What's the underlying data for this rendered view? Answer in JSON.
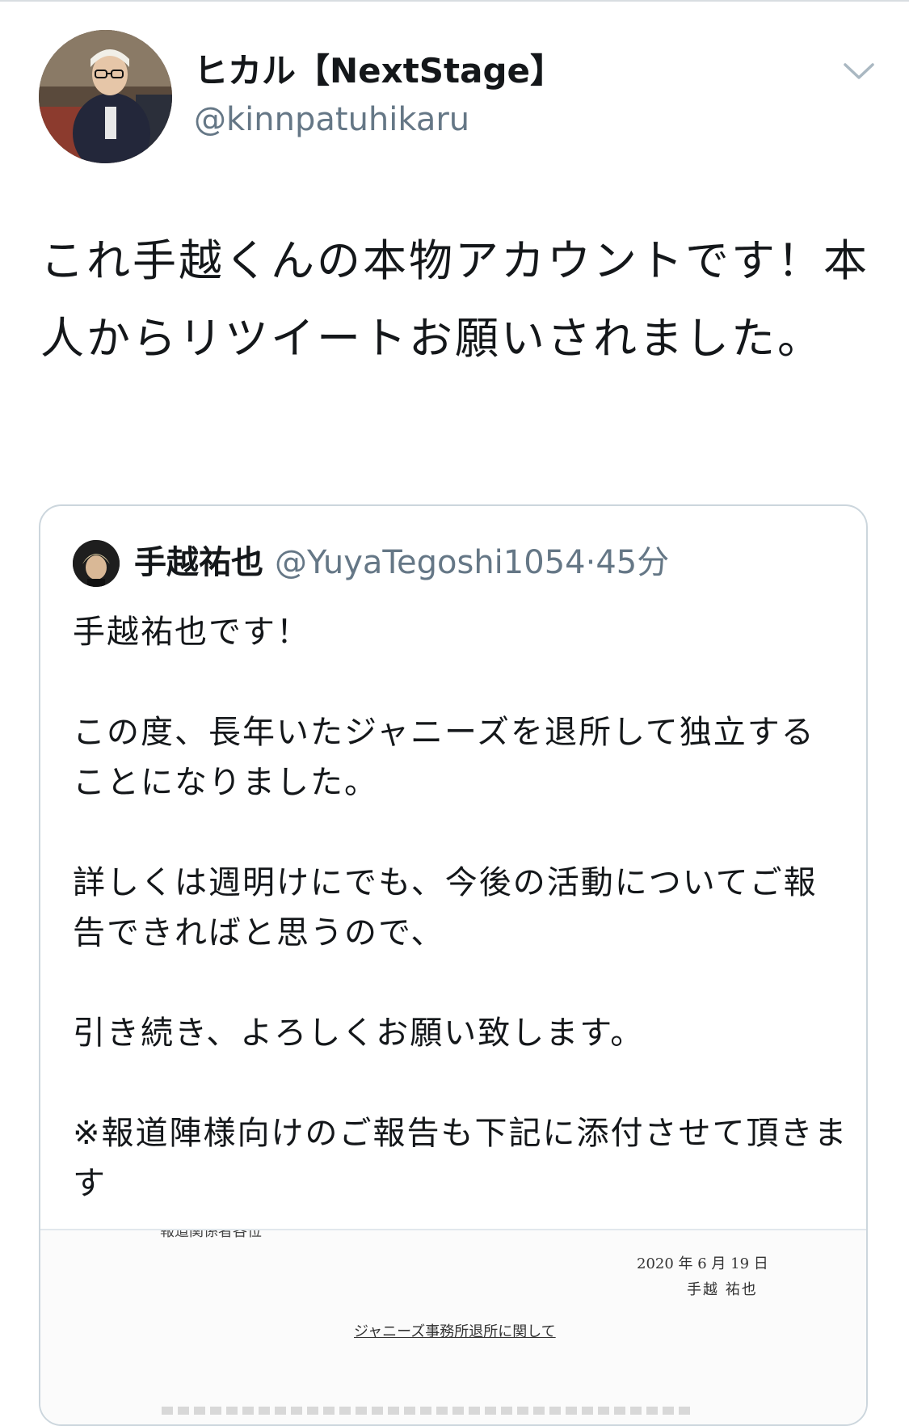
{
  "author": {
    "name": "ヒカル【NextStage】",
    "handle": "@kinnpatuhikaru"
  },
  "tweet": {
    "text": "これ手越くんの本物アカウントです！本人からリツイートお願いされました。"
  },
  "quoted": {
    "name": "手越祐也",
    "handle": "@YuyaTegoshi1054",
    "separator": "·",
    "time": "45分",
    "text": "手越祐也です！\n\nこの度、長年いたジャニーズを退所して独立することになりました。\n\n詳しくは週明けにでも、今後の活動についてご報告できればと思うので、\n\n引き続き、よろしくお願い致します。\n\n※報道陣様向けのご報告も下記に添付させて頂きます",
    "media": {
      "addressee": "報道関係者各位",
      "date": "2020 年 6 月 19 日",
      "signer": "手越 祐也",
      "subject": "ジャニーズ事務所退所に関して"
    }
  },
  "icons": {
    "menu": "chevron-down-icon"
  },
  "colors": {
    "text": "#14171a",
    "secondary": "#657786",
    "border": "#ccd6dd"
  }
}
